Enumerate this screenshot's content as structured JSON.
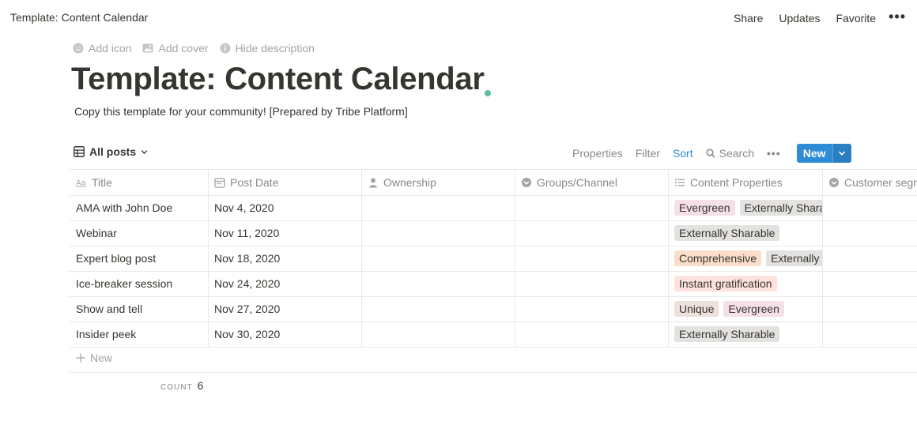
{
  "topbar": {
    "breadcrumb": "Template: Content Calendar",
    "share": "Share",
    "updates": "Updates",
    "favorite": "Favorite",
    "more": "•••"
  },
  "page": {
    "add_icon": "Add icon",
    "add_cover": "Add cover",
    "hide_description": "Hide description",
    "title": "Template: Content Calendar",
    "description": "Copy this template for your community! [Prepared by Tribe Platform]"
  },
  "view": {
    "name": "All posts",
    "properties": "Properties",
    "filter": "Filter",
    "sort": "Sort",
    "search": "Search",
    "more": "•••",
    "new": "New"
  },
  "colors": {
    "accent": "#2e8cd6",
    "pink": "#f5e0e9",
    "gray": "#e3e2e0",
    "orange": "#fadec9",
    "red": "#ffe2dd",
    "brown": "#eee0da"
  },
  "table": {
    "columns": [
      {
        "label": "Title",
        "icon": "text-aa-icon"
      },
      {
        "label": "Post Date",
        "icon": "calendar-icon"
      },
      {
        "label": "Ownership",
        "icon": "person-icon"
      },
      {
        "label": "Groups/Channel",
        "icon": "select-circle-icon"
      },
      {
        "label": "Content Properties",
        "icon": "list-icon"
      },
      {
        "label": "Customer segr",
        "icon": "select-circle-icon"
      }
    ],
    "rows": [
      {
        "title": "AMA with John Doe",
        "date": "Nov 4, 2020",
        "tags": [
          {
            "text": "Evergreen",
            "color": "#f5e0e9"
          },
          {
            "text": "Externally Shara",
            "color": "#e3e2e0"
          }
        ]
      },
      {
        "title": "Webinar",
        "date": "Nov 11, 2020",
        "tags": [
          {
            "text": "Externally Sharable",
            "color": "#e3e2e0"
          }
        ]
      },
      {
        "title": "Expert blog post",
        "date": "Nov 18, 2020",
        "tags": [
          {
            "text": "Comprehensive",
            "color": "#fadec9"
          },
          {
            "text": "Externally",
            "color": "#e3e2e0"
          }
        ]
      },
      {
        "title": "Ice-breaker session",
        "date": "Nov 24, 2020",
        "tags": [
          {
            "text": "Instant gratification",
            "color": "#ffe2dd"
          }
        ]
      },
      {
        "title": "Show and tell",
        "date": "Nov 27, 2020",
        "tags": [
          {
            "text": "Unique",
            "color": "#eee0da"
          },
          {
            "text": "Evergreen",
            "color": "#f5e0e9"
          }
        ]
      },
      {
        "title": "Insider peek",
        "date": "Nov 30, 2020",
        "tags": [
          {
            "text": "Externally Sharable",
            "color": "#e3e2e0"
          }
        ]
      }
    ],
    "new_row": "New",
    "count_label": "COUNT",
    "count_value": "6"
  }
}
